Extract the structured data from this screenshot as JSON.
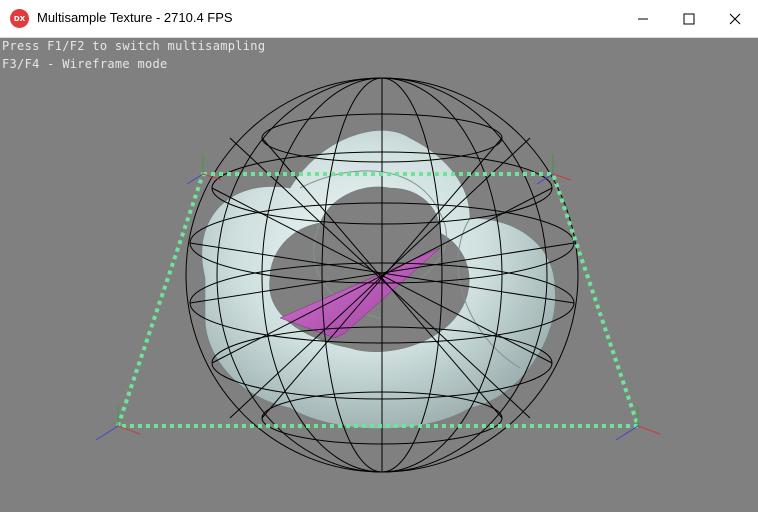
{
  "window": {
    "title": "Multisample Texture - 2710.4 FPS",
    "app_icon_text": "DX",
    "buttons": [
      "minimize-icon",
      "maximize-icon",
      "close-icon"
    ]
  },
  "overlay": {
    "line1": "Press F1/F2 to switch multisampling",
    "line2": "F3/F4 - Wireframe mode"
  },
  "scene": {
    "background_color": "#808080",
    "torus_color": "#cfe0df",
    "cone_color": "#c45fc4",
    "dotted_line_color": "#6fe39a",
    "wireframe_color": "#000000"
  }
}
